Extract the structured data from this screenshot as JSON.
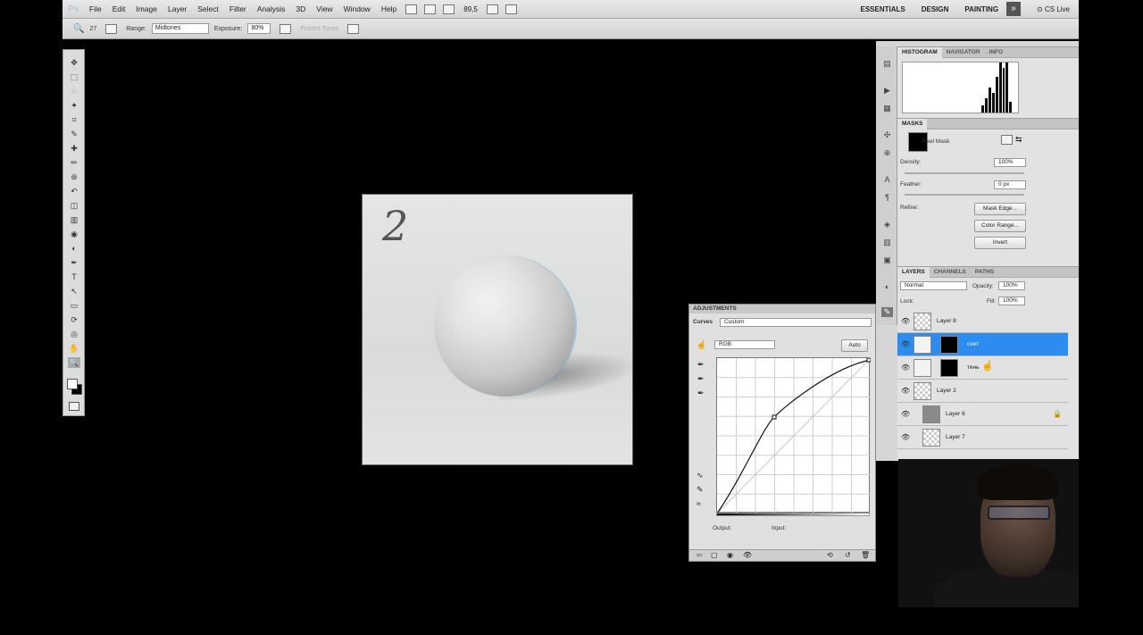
{
  "app": {
    "logo": "Ps"
  },
  "menu": [
    "File",
    "Edit",
    "Image",
    "Layer",
    "Select",
    "Filter",
    "Analysis",
    "3D",
    "View",
    "Window",
    "Help"
  ],
  "toolbar": {
    "zoom": "89,5"
  },
  "workspaces": [
    "ESSENTIALS",
    "DESIGN",
    "PAINTING"
  ],
  "more_label": "»",
  "cslive": "CS Live",
  "options": {
    "brush_size": "27",
    "range_label": "Range:",
    "range_value": "Midtones",
    "exposure_label": "Exposure:",
    "exposure_value": "80%",
    "protect_tones": "Protect Tones"
  },
  "canvas": {
    "digit": "2"
  },
  "tools": [
    "move-icon",
    "marquee-icon",
    "lasso-icon",
    "quick-select-icon",
    "crop-icon",
    "eyedropper-icon",
    "healing-icon",
    "brush-icon",
    "clone-stamp-icon",
    "history-brush-icon",
    "eraser-icon",
    "gradient-icon",
    "blur-icon",
    "dodge-icon",
    "pen-icon",
    "type-icon",
    "path-select-icon",
    "shape-icon",
    "3d-rotate-icon",
    "3d-orbit-icon",
    "hand-icon",
    "zoom-icon"
  ],
  "histogram_panel": {
    "tabs": [
      "HISTOGRAM",
      "NAVIGATOR",
      "INFO"
    ]
  },
  "masks_panel": {
    "tab": "MASKS",
    "pixel_mask": "Pixel Mask",
    "density_label": "Density:",
    "density_value": "100%",
    "feather_label": "Feather:",
    "feather_value": "0 px",
    "refine_label": "Refine:",
    "mask_edge": "Mask Edge...",
    "color_range": "Color Range...",
    "invert": "Invert"
  },
  "layers_panel": {
    "tabs": [
      "LAYERS",
      "CHANNELS",
      "PATHS"
    ],
    "blend_mode": "Normal",
    "opacity_label": "Opacity:",
    "opacity_value": "100%",
    "lock_label": "Lock:",
    "fill_label": "Fill:",
    "fill_value": "100%",
    "layers": [
      {
        "name": "Layer 8"
      },
      {
        "name": "сvет"
      },
      {
        "name": "тень"
      },
      {
        "name": "Layer 2"
      },
      {
        "name": "Layer 6"
      },
      {
        "name": "Layer 7"
      }
    ]
  },
  "adjustments": {
    "title": "ADJUSTMENTS",
    "type": "Curves",
    "preset": "Custom",
    "channel": "RGB",
    "auto": "Auto",
    "output": "Output:",
    "input": "Input:"
  }
}
